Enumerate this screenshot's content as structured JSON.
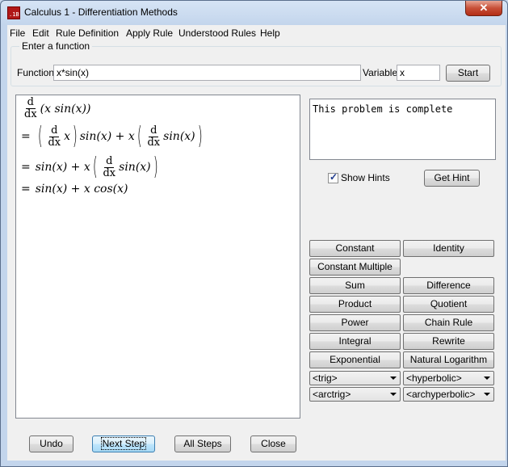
{
  "window": {
    "title": "Calculus 1 - Differentiation Methods",
    "close_label": "✕"
  },
  "menu": [
    "File",
    "Edit",
    "Rule Definition",
    "Apply Rule",
    "Understood Rules",
    "Help"
  ],
  "input_group": {
    "label": "Enter a function",
    "function_label": "Function",
    "function_value": "x*sin(x)",
    "variable_label": "Variable",
    "variable_value": "x",
    "start_label": "Start"
  },
  "steps": {
    "line1": {
      "d": "d",
      "dx": "dx",
      "expr": "(x sin(x))"
    },
    "line2": {
      "eq": "=",
      "d": "d",
      "dx": "dx",
      "x1": "x",
      "mid": "sin(x) + x",
      "sinx": "sin(x)"
    },
    "line3": {
      "eq": "=",
      "lead": "sin(x) + x",
      "d": "d",
      "dx": "dx",
      "sinx": "sin(x)"
    },
    "line4": {
      "eq": "=",
      "expr": "sin(x) + x cos(x)"
    }
  },
  "status_text": "This problem is complete",
  "hints": {
    "show_hints_label": "Show Hints",
    "show_hints_checked": true,
    "get_hint_label": "Get Hint"
  },
  "rules": {
    "constant": "Constant",
    "identity": "Identity",
    "constant_multiple": "Constant Multiple",
    "sum": "Sum",
    "difference": "Difference",
    "product": "Product",
    "quotient": "Quotient",
    "power": "Power",
    "chain_rule": "Chain Rule",
    "integral": "Integral",
    "rewrite": "Rewrite",
    "exponential": "Exponential",
    "natural_logarithm": "Natural Logarithm"
  },
  "combos": {
    "trig": "<trig>",
    "hyperbolic": "<hyperbolic>",
    "arctrig": "<arctrig>",
    "archyperbolic": "<archyperbolic>"
  },
  "bottom_buttons": {
    "undo": "Undo",
    "next_step": "Next Step",
    "all_steps": "All Steps",
    "close": "Close"
  }
}
